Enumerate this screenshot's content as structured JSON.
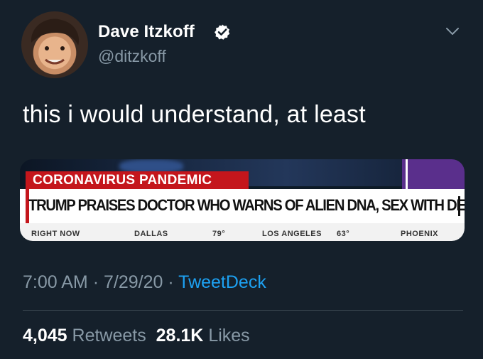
{
  "user": {
    "display_name": "Dave Itzkoff",
    "handle": "@ditzkoff",
    "verified": true
  },
  "tweet": {
    "text": "this i would understand, at least"
  },
  "media": {
    "banner": "CORONAVIRUS PANDEMIC",
    "headline": "TRUMP PRAISES DOCTOR WHO WARNS OF ALIEN DNA, SEX WITH DEMONS",
    "ticker": [
      "RIGHT NOW",
      "DALLAS",
      "79°",
      "LOS ANGELES",
      "63°",
      "PHOENIX"
    ]
  },
  "meta": {
    "time": "7:00 AM",
    "date": "7/29/20",
    "source": "TweetDeck"
  },
  "stats": {
    "retweets_count": "4,045",
    "retweets_label": "Retweets",
    "likes_count": "28.1K",
    "likes_label": "Likes"
  },
  "colors": {
    "background": "#15202b",
    "secondary_text": "#8899a6",
    "link": "#1da1f2",
    "cnn_red": "#c4161c"
  },
  "icons": {
    "verified": "verified-badge-icon",
    "menu": "chevron-down-icon"
  }
}
